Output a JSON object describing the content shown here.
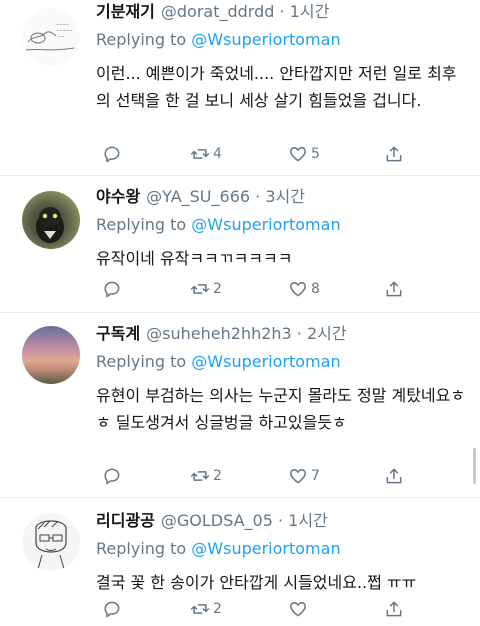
{
  "tweets": [
    {
      "name": "기분재기",
      "handle": "@dorat_ddrdd · 1시간",
      "replying_prefix": "Replying to ",
      "replying_to": "@Wsuperiortoman",
      "text": "이런... 예쁜이가 죽었네.... 안타깝지만 저런 일로 최후의 선택을 한 걸 보니 세상 살기 힘들었을 겁니다.",
      "retweets": "4",
      "likes": "5",
      "avatar": "sketch-avatar"
    },
    {
      "name": "야수왕",
      "handle": "@YA_SU_666 · 3시간",
      "replying_prefix": "Replying to ",
      "replying_to": "@Wsuperiortoman",
      "text": "유작이네 유작ㅋㅋㄲㅋㅋㅋㅋ",
      "retweets": "2",
      "likes": "8",
      "avatar": "animal-photo-avatar"
    },
    {
      "name": "구독계",
      "handle": "@suheheh2hh2h3 · 2시간",
      "replying_prefix": "Replying to ",
      "replying_to": "@Wsuperiortoman",
      "text": "유현이 부검하는 의사는 누군지 몰라도 정말 계탔네요ㅎㅎ 딜도생겨서 싱글벙글 하고있을듯ㅎ",
      "retweets": "2",
      "likes": "7",
      "avatar": "sunset-sky-avatar"
    },
    {
      "name": "리디광공",
      "handle": "@GOLDSA_05 · 1시간",
      "replying_prefix": "Replying to ",
      "replying_to": "@Wsuperiortoman",
      "text": "결국 꽃 한 송이가 안타깝게 시들었네요..쩝 ㅠㅠ",
      "retweets": "2",
      "likes": "",
      "avatar": "drawn-face-avatar"
    }
  ],
  "colors": {
    "link": "#1da1f2",
    "muted": "#657786",
    "divider": "#e6ecf0"
  }
}
